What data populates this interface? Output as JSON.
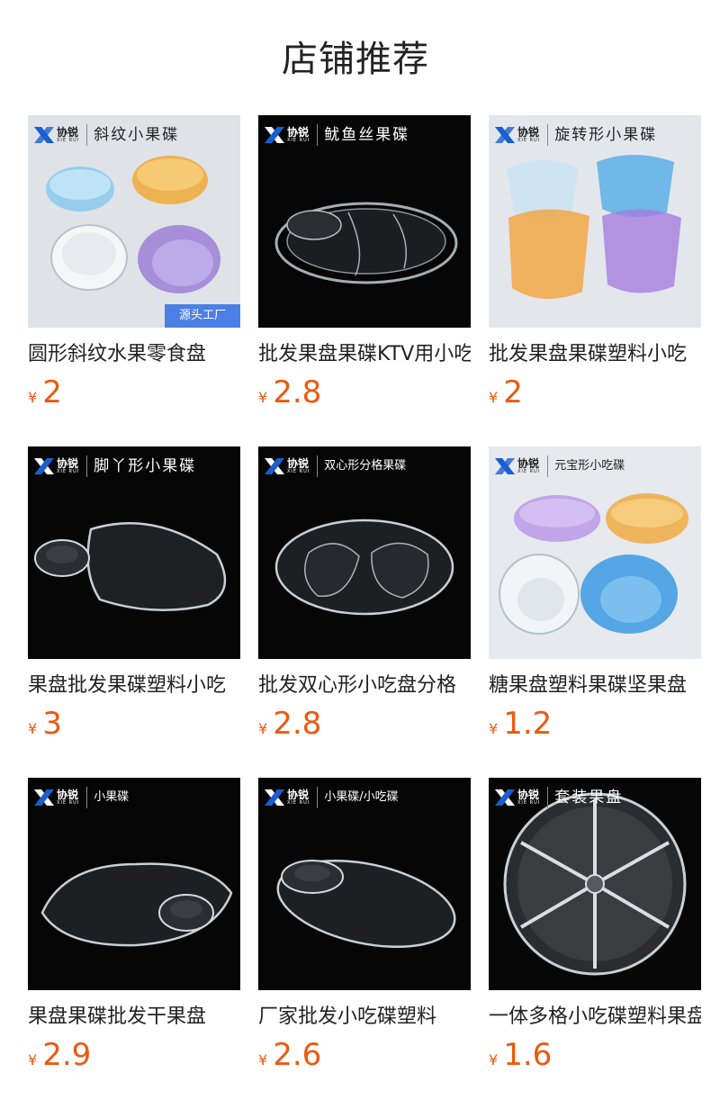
{
  "page_title": "店铺推荐",
  "brand": {
    "name": "协锐",
    "sub": "XIE RUI"
  },
  "currency": "¥",
  "products": [
    {
      "caption": "斜纹小果碟",
      "name": "圆形斜纹水果零食盘",
      "price": "2",
      "badge": "源头工厂",
      "theme": "light"
    },
    {
      "caption": "鱿鱼丝果碟",
      "name": "批发果盘果碟KTV用小吃",
      "price": "2.8",
      "theme": "dark"
    },
    {
      "caption": "旋转形小果碟",
      "name": "批发果盘果碟塑料小吃",
      "price": "2",
      "theme": "light"
    },
    {
      "caption": "脚丫形小果碟",
      "name": "果盘批发果碟塑料小吃",
      "price": "3",
      "theme": "dark"
    },
    {
      "caption": "双心形分格果碟",
      "name": "批发双心形小吃盘分格",
      "price": "2.8",
      "theme": "dark"
    },
    {
      "caption": "元宝形小吃碟",
      "name": "糖果盘塑料果碟坚果盘",
      "price": "1.2",
      "theme": "light"
    },
    {
      "caption": "小果碟",
      "name": "果盘果碟批发干果盘",
      "price": "2.9",
      "theme": "dark"
    },
    {
      "caption": "小果碟/小吃碟",
      "name": "厂家批发小吃碟塑料",
      "price": "2.6",
      "theme": "dark"
    },
    {
      "caption": "套装果盘",
      "name": "一体多格小吃碟塑料果盘",
      "price": "1.6",
      "theme": "dark"
    }
  ],
  "colors": {
    "price": "#ea5a12",
    "badge": "#4c7fe6",
    "logo": "#1a5fd0"
  }
}
